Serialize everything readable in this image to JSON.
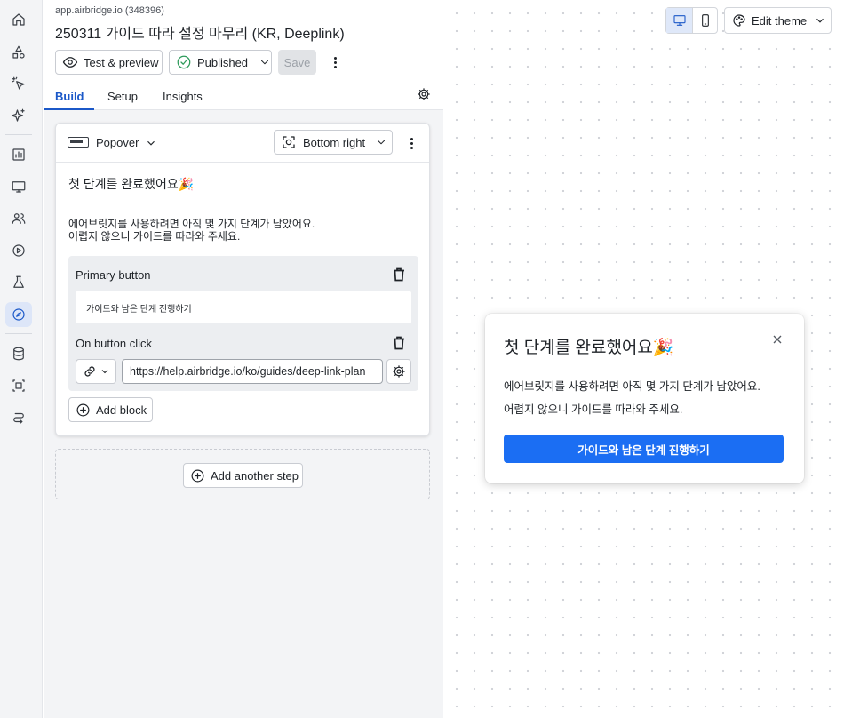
{
  "header": {
    "app_id": "app.airbridge.io (348396)",
    "title": "250311 가이드 따라 설정 마무리 (KR, Deeplink)",
    "test_preview_label": "Test & preview",
    "status_label": "Published",
    "save_label": "Save"
  },
  "tabs": [
    {
      "label": "Build",
      "active": true
    },
    {
      "label": "Setup",
      "active": false
    },
    {
      "label": "Insights",
      "active": false
    }
  ],
  "step": {
    "type_label": "Popover",
    "position_label": "Bottom right",
    "title": "첫 단계를 완료했어요🎉",
    "body_line1": "에어브릿지를 사용하려면 아직 몇 가지 단계가 남았어요.",
    "body_line2": "어렵지 않으니 가이드를 따라와 주세요.",
    "primary_button": {
      "label": "Primary button",
      "text": "가이드와 남은 단계 진행하기",
      "on_click_label": "On button click",
      "url": "https://help.airbridge.io/ko/guides/deep-link-plan"
    },
    "add_block_label": "Add block"
  },
  "add_step_label": "Add another step",
  "canvas": {
    "edit_theme_label": "Edit theme",
    "device": "desktop"
  },
  "preview": {
    "title": "첫 단계를 완료했어요🎉",
    "line1": "에어브릿지를 사용하려면 아직 몇 가지 단계가 남았어요.",
    "line2": "어렵지 않으니 가이드를 따라와 주세요.",
    "cta_label": "가이드와 남은 단계 진행하기"
  },
  "sidebar_icons": [
    "home-icon",
    "shapes-icon",
    "magic-click-icon",
    "sparkles-icon",
    "chart-icon",
    "monitor-icon",
    "users-icon",
    "play-icon",
    "flask-icon",
    "compass-icon",
    "database-icon",
    "component-icon",
    "route-icon"
  ],
  "colors": {
    "accent": "#1b58c8",
    "cta": "#1b6ef3",
    "published": "#2e9b5b"
  }
}
